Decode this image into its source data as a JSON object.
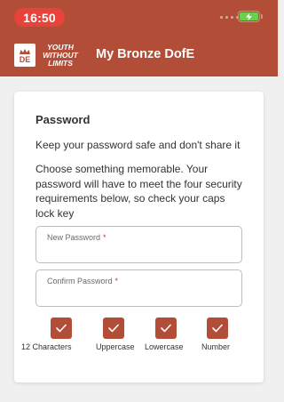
{
  "status_bar": {
    "time": "16:50"
  },
  "header": {
    "logo_de_text": "DE",
    "logo_ywl_lines": [
      "YOUTH",
      "WITHOUT",
      "LIMITS"
    ],
    "title": "My Bronze DofE",
    "brand_color": "#b24e37"
  },
  "card": {
    "title": "Password",
    "subtitle": "Keep your password safe and don't share it",
    "body": "Choose something memorable. Your password will have to meet the four security requirements below, so check your caps lock key",
    "fields": [
      {
        "label": "New Password",
        "required_mark": "*",
        "value": ""
      },
      {
        "label": "Confirm Password",
        "required_mark": "*",
        "value": ""
      }
    ],
    "requirements": [
      {
        "label": "12 Characters",
        "checked": true,
        "icon": "check-icon"
      },
      {
        "label": "Uppercase",
        "checked": true,
        "icon": "check-icon"
      },
      {
        "label": "Lowercase",
        "checked": true,
        "icon": "check-icon"
      },
      {
        "label": "Number",
        "checked": true,
        "icon": "check-icon"
      }
    ]
  }
}
